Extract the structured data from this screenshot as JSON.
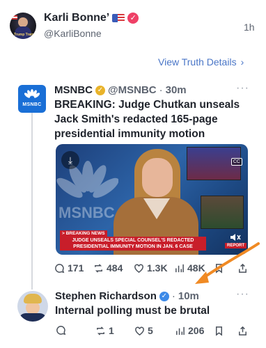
{
  "post": {
    "author_name": "Karli Bonne’",
    "author_handle": "@KarliBonne",
    "time": "1h",
    "view_details_label": "View Truth Details",
    "avatar_text": "Trump Train"
  },
  "quoted": {
    "name": "MSNBC",
    "handle": "@MSNBC",
    "separator": "·",
    "time": "30m",
    "more": "···",
    "text": "BREAKING: Judge Chutkan unseals Jack Smith's redacted 165-page presidential immunity motion",
    "avatar_label": "MSNBC",
    "video": {
      "watermark": "MSNBC",
      "breaking_tag": "> BREAKING NEWS",
      "chyron_line1": "JUDGE UNSEALS SPECIAL COUNSEL'S REDACTED",
      "chyron_line2": "PRESIDENTIAL IMMUNITY MOTION IN JAN. 6 CASE",
      "report_tag": "REPORT",
      "cc_label": "CC"
    },
    "stats": {
      "replies": "171",
      "retruths": "484",
      "likes": "1.3K",
      "views": "48K"
    }
  },
  "reply": {
    "name": "Stephen Richardson",
    "separator": "·",
    "time": "10m",
    "more": "···",
    "text": "Internal polling must be brutal",
    "stats": {
      "retruths": "1",
      "likes": "5",
      "views": "206"
    }
  },
  "colors": {
    "link": "#4a76c7",
    "verified_pink": "#ef4066",
    "verified_gold": "#e9b32a",
    "verified_blue": "#3d8ae8",
    "arrow": "#f08a24",
    "msnbc_blue": "#1a6fd6",
    "chyron_red": "#c81e2a"
  },
  "icons": {
    "reply": "speech-bubble-icon",
    "retruth": "repost-icon",
    "like": "heart-icon",
    "views": "bar-chart-icon",
    "bookmark": "bookmark-icon",
    "share": "share-icon"
  }
}
